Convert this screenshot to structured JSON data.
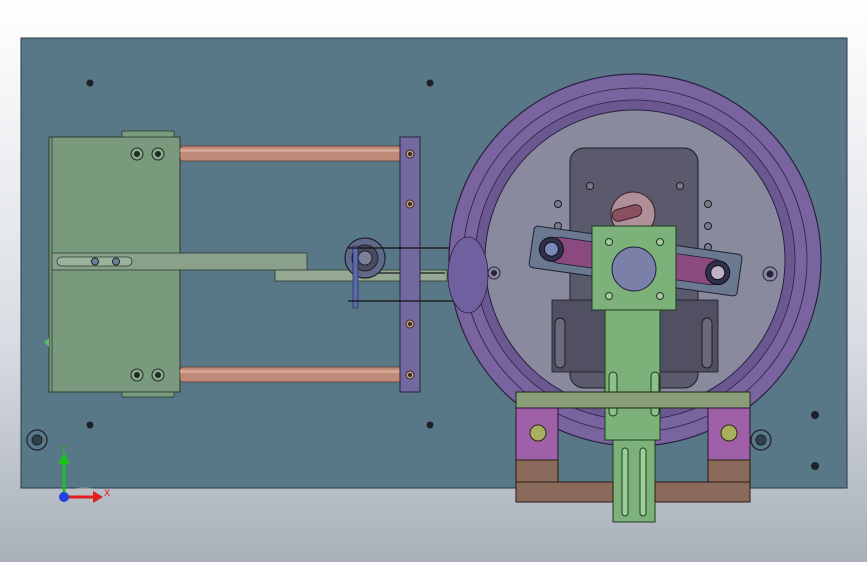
{
  "triad": {
    "x_label": "X",
    "y_label": "Y",
    "x_color": "#e02020",
    "y_color": "#20c020",
    "z_color": "#2040e0"
  },
  "colors": {
    "baseplate": "#587787",
    "block_green": "#7a9a7e",
    "rod_copper": "#c08a78",
    "bracket_purple": "#7468a0",
    "disc_outer": "#7a64a0",
    "disc_inner": "#8a8a9e",
    "motor_dark": "#585868",
    "arm_green": "#7cb27a",
    "support_magenta": "#a060a8",
    "support_olive": "#a8b060",
    "support_brown": "#8a6a5a"
  }
}
